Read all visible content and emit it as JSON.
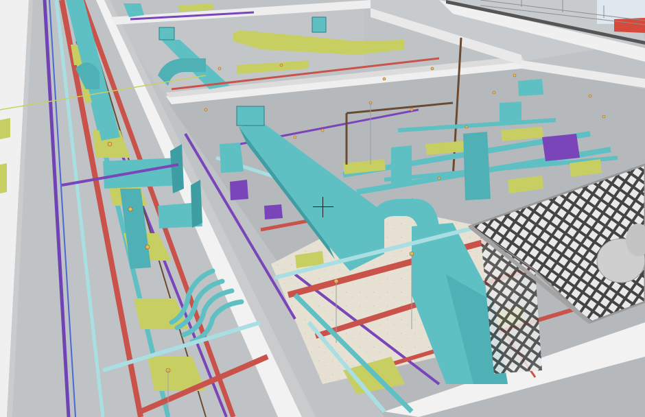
{
  "viewer": {
    "view_mode": "3d-perspective",
    "cursor": "crosshair-icon"
  },
  "colors": {
    "duct": "#5fc0c4",
    "duct_dark": "#3f9ea3",
    "pipe_red": "#c9524a",
    "pipe_purple": "#7a45b8",
    "pipe_light": "#a9dfe2",
    "pipe_brown": "#6b4a32",
    "tray_yellow": "#c8cf62",
    "wall_white": "#f1f1f1",
    "wall_top": "#e8e9ea",
    "floor_gray": "#b9bdc0",
    "floor_light": "#e7e3d6",
    "grating": "#7b7b7b",
    "tank": "#c9c9c9"
  }
}
